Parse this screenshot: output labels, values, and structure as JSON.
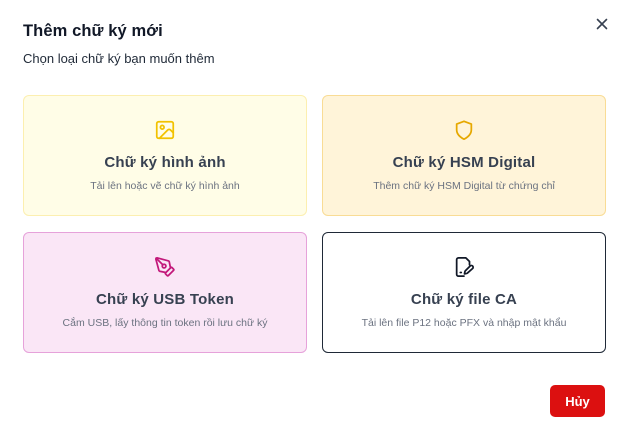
{
  "dialog": {
    "title": "Thêm chữ ký mới",
    "subtitle": "Chọn loại chữ ký bạn muốn thêm",
    "close_icon": "close-icon"
  },
  "options": [
    {
      "title": "Chữ ký hình ảnh",
      "description": "Tải lên hoặc vẽ chữ ký hình ảnh",
      "icon": "image-icon",
      "color": "#f2c200"
    },
    {
      "title": "Chữ ký HSM Digital",
      "description": "Thêm chữ ký HSM Digital từ chứng chỉ",
      "icon": "shield-icon",
      "color": "#e6a800"
    },
    {
      "title": "Chữ ký USB Token",
      "description": "Cắm USB, lấy thông tin token rồi lưu chữ ký",
      "icon": "pen-nib-icon",
      "color": "#c2187a"
    },
    {
      "title": "Chữ ký file CA",
      "description": "Tải lên file P12 hoặc PFX và nhập mật khẩu",
      "icon": "file-signature-icon",
      "color": "#111827"
    }
  ],
  "footer": {
    "cancel_label": "Hủy",
    "cancel_color": "#dc1010"
  }
}
